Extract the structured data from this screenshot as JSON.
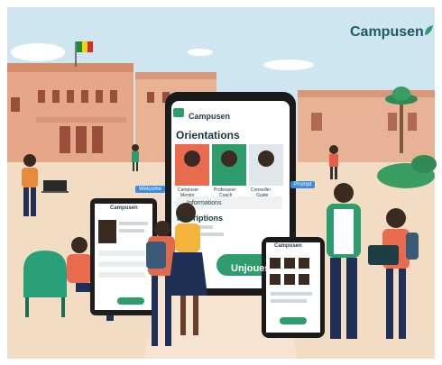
{
  "brand": {
    "logo_text": "Campusen",
    "app_name": "Campusen"
  },
  "main_phone": {
    "section_title": "Orientations",
    "people": [
      {
        "name": "Campuser",
        "role": "Mentor"
      },
      {
        "name": "Professeur",
        "role": "Coach"
      },
      {
        "name": "Conseiller",
        "role": "Guide"
      }
    ],
    "info_label": "Informations",
    "sub_section": "Inscriptions",
    "join_button": "Unjoues"
  },
  "tags": {
    "left_tag": "Welcome",
    "right_tag": "Prompt"
  },
  "colors": {
    "brand": "#1b5b66",
    "accent_green": "#2f9c6e",
    "sky": "#bfe0f0",
    "ground": "#f4d9bd",
    "building": "#e7a98a"
  }
}
